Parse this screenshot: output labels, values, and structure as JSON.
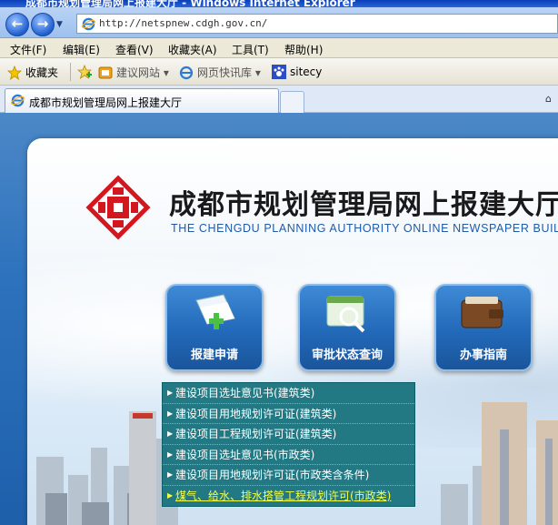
{
  "window": {
    "title": "成都市规划管理局网上报建大厅 - Windows Internet Explorer",
    "url": "http://netspnew.cdgh.gov.cn/"
  },
  "menu": [
    "文件(F)",
    "编辑(E)",
    "查看(V)",
    "收藏夹(A)",
    "工具(T)",
    "帮助(H)"
  ],
  "favorites": {
    "label": "收藏夹",
    "items": [
      "建议网站 ▾",
      "网页快讯库 ▾",
      "sitecy"
    ]
  },
  "tab": {
    "label": "成都市规划管理局网上报建大厅"
  },
  "site": {
    "title": "成都市规划管理局网上报建大厅",
    "subtitle": "THE CHENGDU PLANNING AUTHORITY ONLINE NEWSPAPER BUILDING",
    "buttons": [
      "报建申请",
      "审批状态查询",
      "办事指南"
    ]
  },
  "dropdown": [
    "建设项目选址意见书(建筑类)",
    "建设项目用地规划许可证(建筑类)",
    "建设项目工程规划许可证(建筑类)",
    "建设项目选址意见书(市政类)",
    "建设项目用地规划许可证(市政类含条件)",
    "煤气、给水、排水搭管工程规划许可(市政类)"
  ],
  "colors": {
    "logo_red": "#d4171e",
    "dropdown_bg": "#18737d",
    "dropdown_hover_text": "#f5ff44"
  }
}
